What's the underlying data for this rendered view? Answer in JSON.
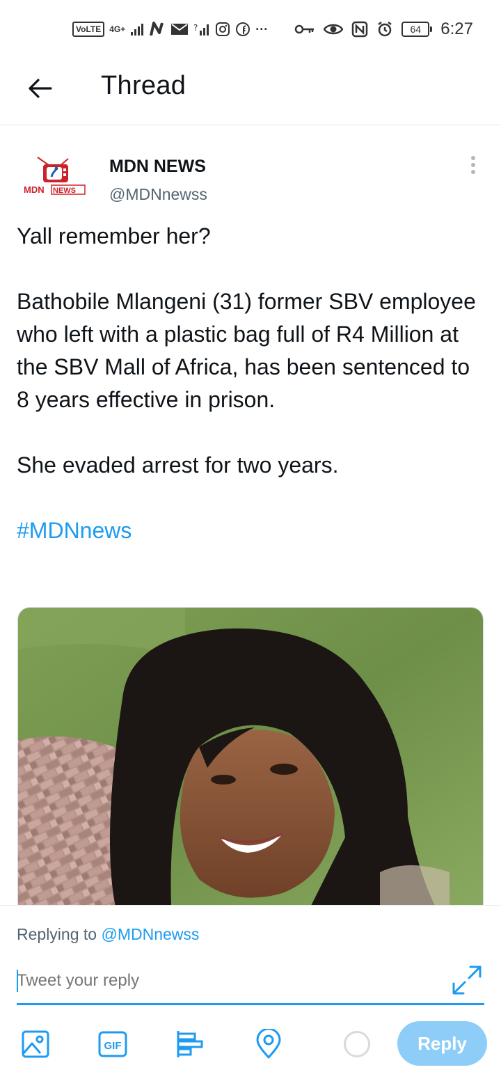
{
  "status_bar": {
    "volte": "VoLTE",
    "network": "4G+",
    "time": "6:27",
    "battery": "64",
    "more": "···"
  },
  "header": {
    "title": "Thread"
  },
  "tweet": {
    "author_name": "MDN NEWS",
    "author_handle": "@MDNnewss",
    "logo_text": "MDN NEWS",
    "line1": "Yall remember her?",
    "paragraph2": "Bathobile Mlangeni (31) former SBV employee who left with a plastic bag full of R4 Million at the SBV Mall of Africa, has been sentenced to 8 years effective in prison.",
    "line3": "She evaded arrest for two years.",
    "hashtag": "#MDNnews"
  },
  "reply": {
    "replying_prefix": "Replying to",
    "replying_handle": "@MDNnewss",
    "placeholder": "Tweet your reply",
    "button_label": "Reply",
    "gif_label": "GIF"
  },
  "colors": {
    "accent": "#1d9bf0",
    "reply_button_disabled": "#8ecdf8",
    "secondary_text": "#536471"
  },
  "icons": {
    "back": "arrow-left-icon",
    "more": "more-vertical-icon",
    "expand": "expand-icon",
    "image": "image-icon",
    "gif": "gif-icon",
    "poll": "poll-icon",
    "location": "location-pin-icon"
  }
}
